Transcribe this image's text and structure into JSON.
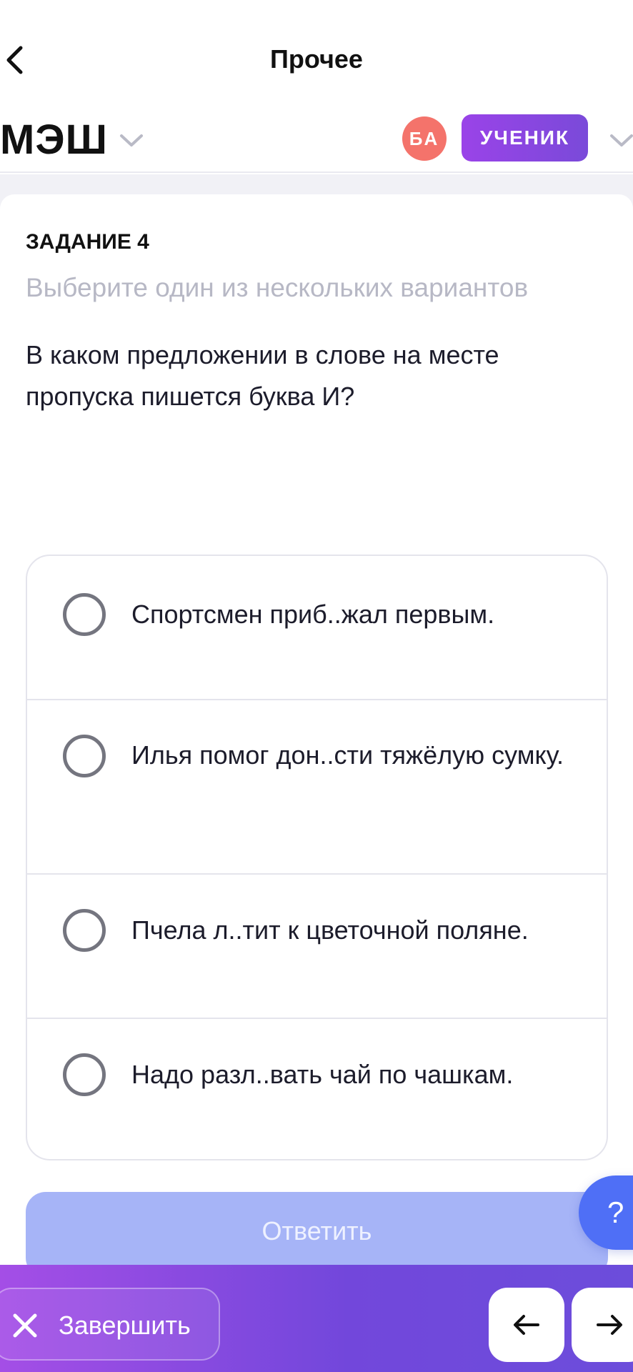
{
  "header": {
    "title": "Прочее"
  },
  "app_bar": {
    "brand": "МЭШ",
    "avatar_initials": "БА",
    "role": "УЧЕНИК",
    "avatar_color": "#f4736b",
    "role_color": "#8a46e0"
  },
  "task": {
    "label": "ЗАДАНИЕ 4",
    "instruction": "Выберите один из нескольких вариантов",
    "question": "В каком предложении в слове на месте пропуска пишется буква И?",
    "options": [
      {
        "text": "Спортсмен приб..жал первым."
      },
      {
        "text": "Илья помог дон..сти тяжёлую сумку."
      },
      {
        "text": "Пчела л..тит к цветочной поляне."
      },
      {
        "text": "Надо разл..вать чай по чашкам."
      }
    ],
    "answer_label": "Ответить",
    "answer_color": "#a6b4f7"
  },
  "help": {
    "label": "?"
  },
  "footer": {
    "finish_label": "Завершить",
    "prev_icon": "arrow-left-icon",
    "next_icon": "arrow-right-icon"
  }
}
